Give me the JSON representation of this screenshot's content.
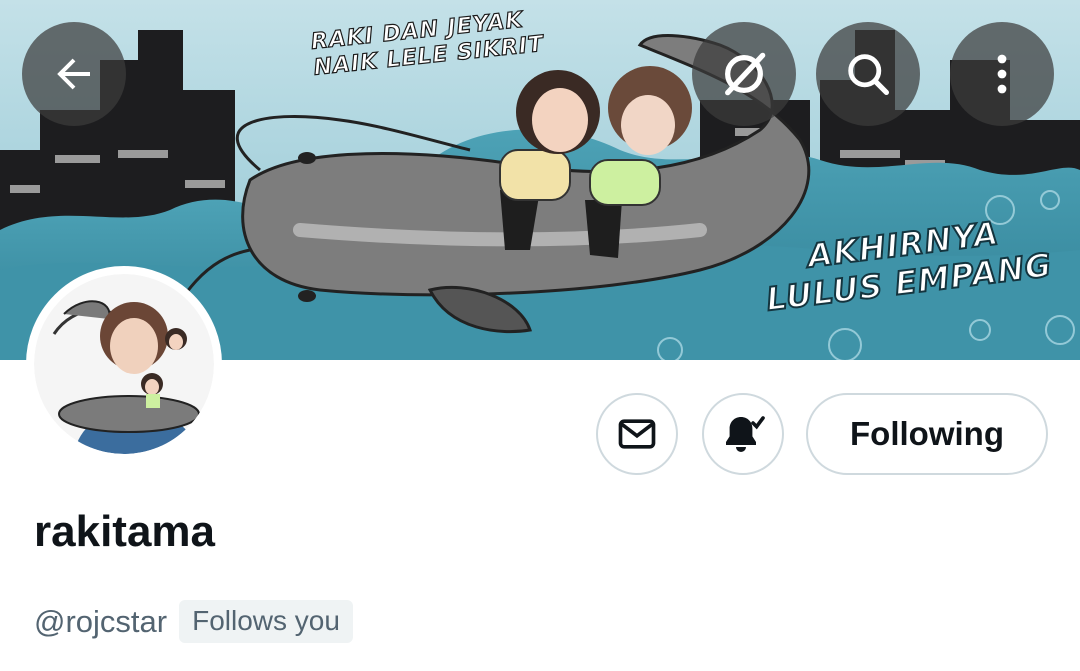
{
  "header": {
    "back_icon": "arrow-left-icon",
    "grok_icon": "grok-icon",
    "search_icon": "search-icon",
    "more_icon": "more-vertical-icon"
  },
  "banner": {
    "top_caption_line1": "RAKI DAN JEYAK",
    "top_caption_line2": "NAIK LELE SIKRIT",
    "bottom_caption_line1": "AKHIRNYA",
    "bottom_caption_line2": "LULUS EMPANG",
    "sky_color": "#9fd0dc",
    "water_color": "#3f93a8"
  },
  "actions": {
    "message_icon": "envelope-icon",
    "notifications_icon": "bell-check-icon",
    "follow_label": "Following"
  },
  "profile": {
    "display_name": "rakitama",
    "handle": "@rojcstar",
    "follows_badge": "Follows you"
  },
  "colors": {
    "text_primary": "#0f1419",
    "text_secondary": "#536471",
    "border": "#cfd9de",
    "badge_bg": "#eff3f4"
  }
}
